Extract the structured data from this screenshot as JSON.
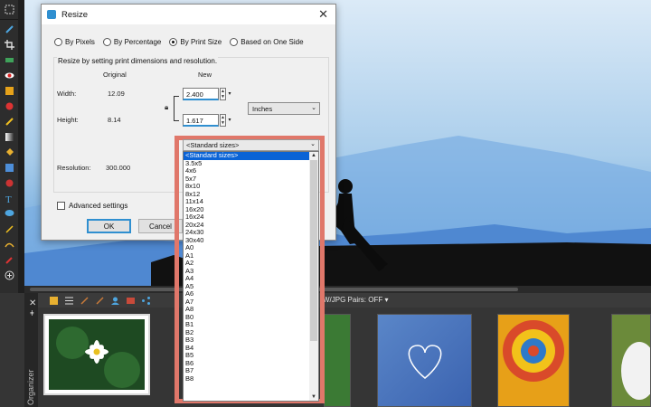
{
  "dialog": {
    "title": "Resize",
    "radios": [
      {
        "label": "By Pixels",
        "checked": false
      },
      {
        "label": "By Percentage",
        "checked": false
      },
      {
        "label": "By Print Size",
        "checked": true
      },
      {
        "label": "Based on One Side",
        "checked": false
      }
    ],
    "group_label": "Resize by setting print dimensions and resolution.",
    "col_original": "Original",
    "col_new": "New",
    "width_label": "Width:",
    "width_original": "12.09",
    "width_new": "2.400",
    "height_label": "Height:",
    "height_original": "8.14",
    "height_new": "1.617",
    "units_value": "Inches",
    "resolution_label": "Resolution:",
    "resolution_original": "300.000",
    "advanced_label": "Advanced settings",
    "ok_label": "OK",
    "cancel_label": "Cancel"
  },
  "dropdown": {
    "selected": "<Standard sizes>",
    "items": [
      "<Standard sizes>",
      "3.5x5",
      "4x6",
      "5x7",
      "8x10",
      "8x12",
      "11x14",
      "16x20",
      "16x24",
      "20x24",
      "24x30",
      "30x40",
      "A0",
      "A1",
      "A2",
      "A3",
      "A4",
      "A5",
      "A6",
      "A7",
      "A8",
      "B0",
      "B1",
      "B2",
      "B3",
      "B4",
      "B5",
      "B6",
      "B7",
      "B8"
    ]
  },
  "organizer": {
    "label": "Organizer",
    "raw_pairs": "W/JPG Pairs: OFF"
  },
  "colors": {
    "highlight": "#e0776a",
    "accent": "#2f8fd0",
    "list_selection": "#0a63d6"
  }
}
